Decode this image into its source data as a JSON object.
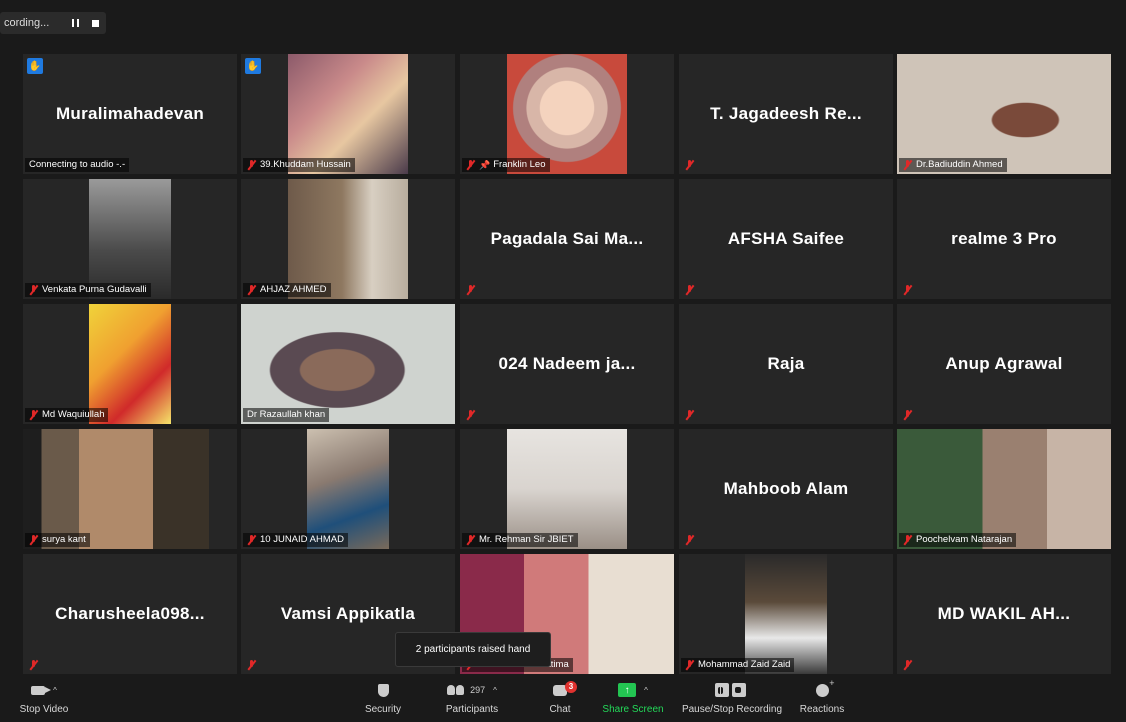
{
  "recording": {
    "label": "cording..."
  },
  "tiles": [
    {
      "id": "muralimahadevan",
      "display_name": "Muralimahadevan",
      "label": "Connecting to audio -.-",
      "muted": false,
      "hand": true
    },
    {
      "id": "khuddam",
      "display_name": "",
      "label": "39.Khuddam Hussain",
      "muted": true,
      "hand": true,
      "video": "v-selfie"
    },
    {
      "id": "franklin",
      "display_name": "",
      "label": "Franklin Leo",
      "muted": true,
      "pinned": true,
      "video": "v-baby"
    },
    {
      "id": "jagadeesh",
      "display_name": "T. Jagadeesh Re...",
      "label": "",
      "muted": true
    },
    {
      "id": "badiuddin",
      "display_name": "",
      "label": "Dr.Badiuddin Ahmed",
      "muted": true,
      "video": "v-man-cap"
    },
    {
      "id": "venkata",
      "display_name": "",
      "label": "Venkata Purna Gudavalli",
      "muted": true,
      "video": "v-bw"
    },
    {
      "id": "ahjaz",
      "display_name": "",
      "label": "AHJAZ AHMED",
      "muted": true,
      "video": "v-ahjaz"
    },
    {
      "id": "pagadala",
      "display_name": "Pagadala Sai Ma...",
      "label": "",
      "muted": true
    },
    {
      "id": "afsha",
      "display_name": "AFSHA Saifee",
      "label": "",
      "muted": true
    },
    {
      "id": "realme",
      "display_name": "realme 3 Pro",
      "label": "",
      "muted": true
    },
    {
      "id": "waquiullah",
      "display_name": "",
      "label": "Md Waquiullah",
      "muted": true,
      "video": "v-yellow"
    },
    {
      "id": "razaullah",
      "display_name": "",
      "label": "Dr Razaullah khan",
      "muted": false,
      "active": true,
      "video": "v-razaullah"
    },
    {
      "id": "nadeem",
      "display_name": "024 Nadeem ja...",
      "label": "",
      "muted": true
    },
    {
      "id": "raja",
      "display_name": "Raja",
      "label": "",
      "muted": true
    },
    {
      "id": "anup",
      "display_name": "Anup Agrawal",
      "label": "",
      "muted": true
    },
    {
      "id": "surya",
      "display_name": "",
      "label": "surya kant",
      "muted": true,
      "video": "v-surya"
    },
    {
      "id": "junaid",
      "display_name": "",
      "label": "10 JUNAID AHMAD",
      "muted": true,
      "video": "v-reader"
    },
    {
      "id": "rehman",
      "display_name": "",
      "label": "Mr. Rehman Sir JBIET",
      "muted": true,
      "video": "v-rehman"
    },
    {
      "id": "mahboob",
      "display_name": "Mahboob Alam",
      "label": "",
      "muted": true
    },
    {
      "id": "poochelvam",
      "display_name": "",
      "label": "Poochelvam Natarajan",
      "muted": true,
      "video": "v-poochel"
    },
    {
      "id": "charusheela",
      "display_name": "Charusheela098...",
      "label": "",
      "muted": true
    },
    {
      "id": "vamsi",
      "display_name": "Vamsi Appikatla",
      "label": "",
      "muted": true
    },
    {
      "id": "fatima",
      "display_name": "",
      "label": "Prof. Sameen Fatima",
      "muted": true,
      "video": "v-fatima"
    },
    {
      "id": "zaid",
      "display_name": "",
      "label": "Mohammad Zaid Zaid",
      "muted": true,
      "video": "v-zaid"
    },
    {
      "id": "wakil",
      "display_name": "MD WAKIL AH...",
      "label": "",
      "muted": true
    }
  ],
  "tooltip": {
    "text": "2 participants raised hand"
  },
  "toolbar": {
    "stop_video": "Stop Video",
    "security": "Security",
    "participants": "Participants",
    "participants_count": "297",
    "chat": "Chat",
    "chat_badge": "3",
    "share_screen": "Share Screen",
    "pause_stop": "Pause/Stop Recording",
    "reactions": "Reactions"
  },
  "colors": {
    "active_border": "#c7d84a",
    "share_green": "#23c552",
    "muted_red": "#e02828",
    "hand_blue": "#1f7ae0"
  }
}
